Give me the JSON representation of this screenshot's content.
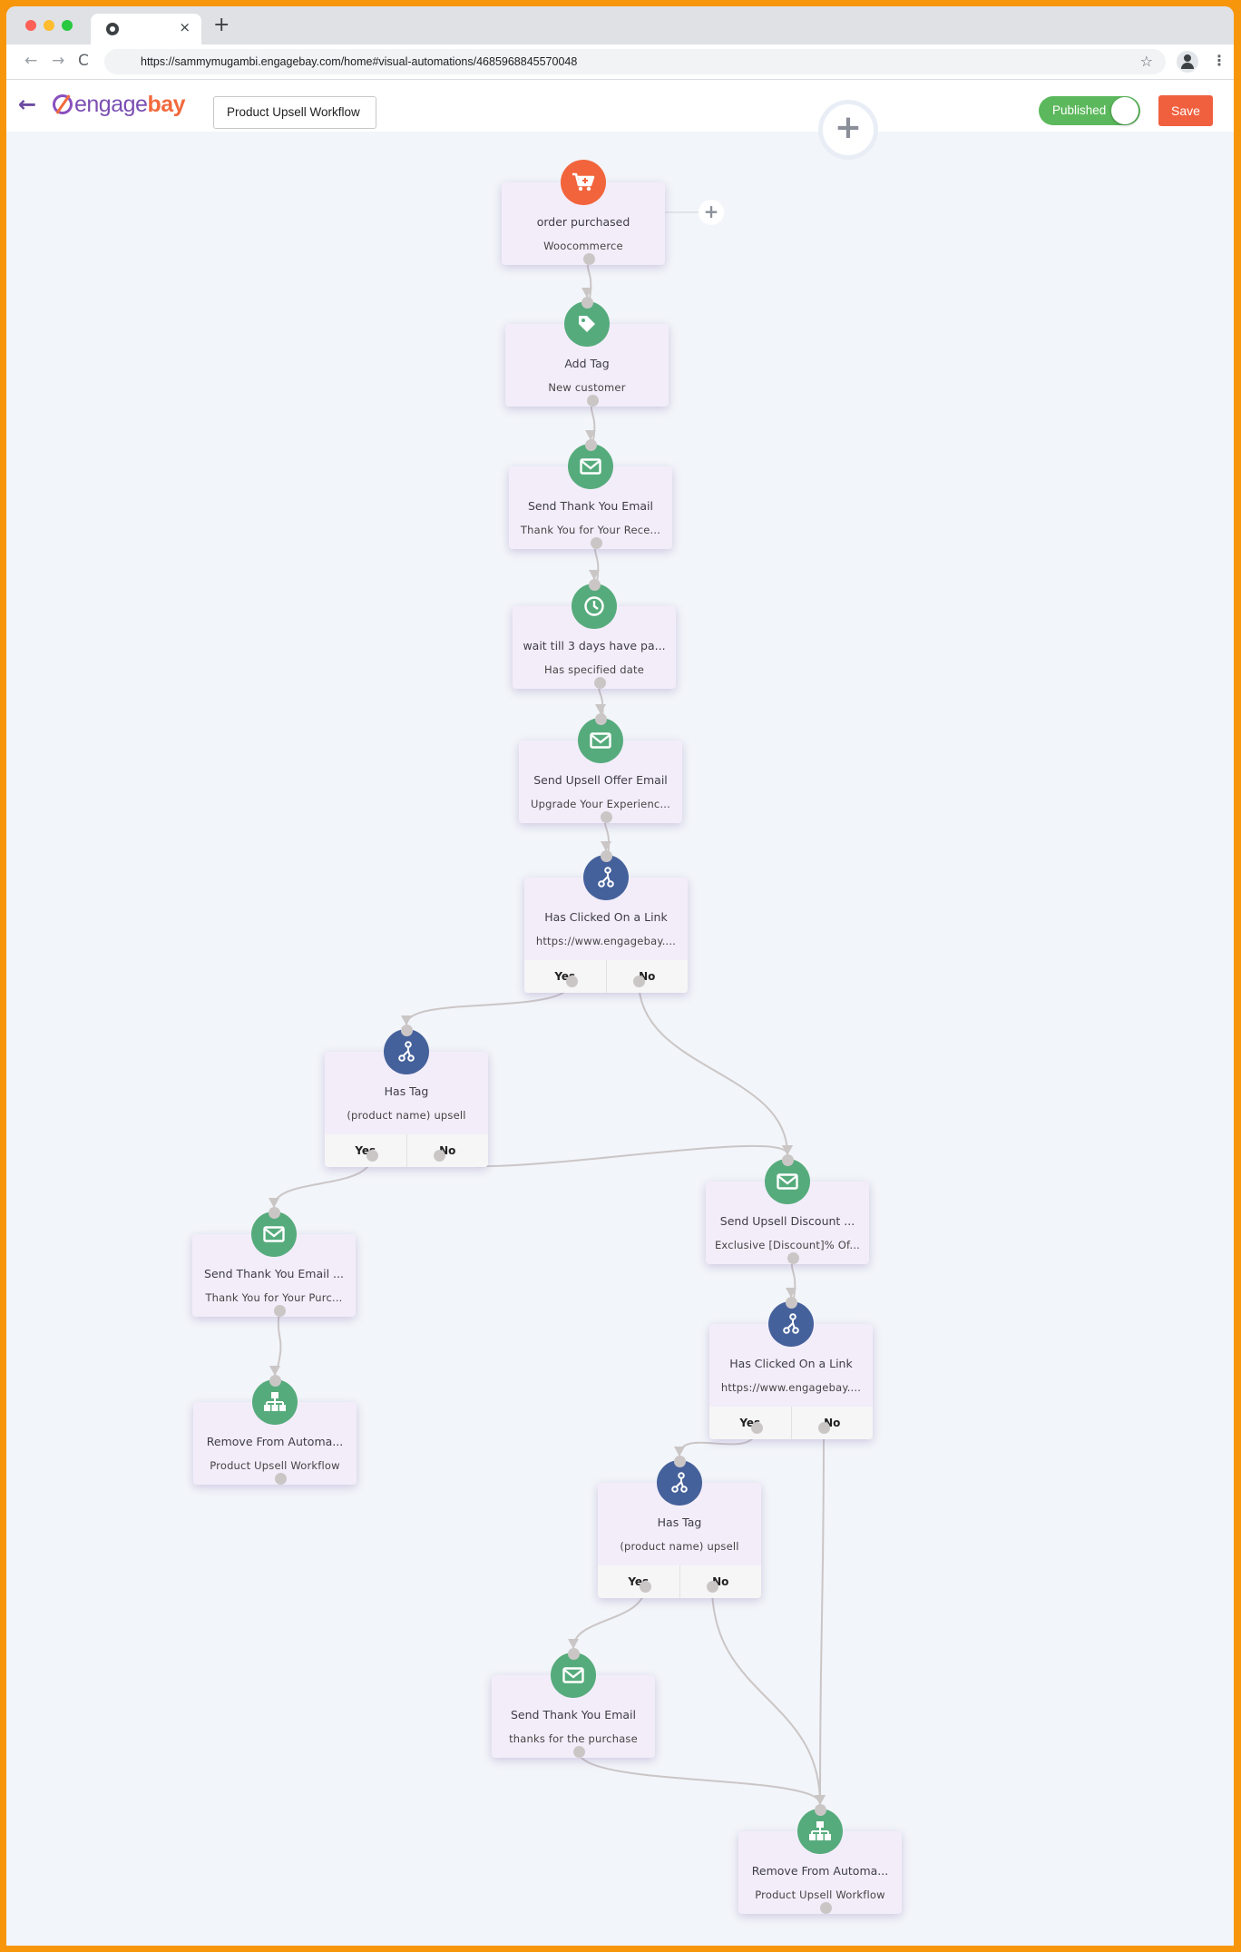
{
  "browser": {
    "tab_close": "×",
    "new_tab": "+",
    "url": "https://sammymugambi.engagebay.com/home#visual-automations/4685968845570048",
    "nav": {
      "back": "←",
      "forward": "→",
      "reload": "C"
    },
    "bookmark_icon": "☆",
    "menu_icon": "⋮"
  },
  "header": {
    "back_icon": "←",
    "logo": {
      "part1": "engage",
      "part2": "bay"
    },
    "workflow_name": "Product Upsell Workflow",
    "published_label": "Published",
    "published": true,
    "save_label": "Save",
    "add_step_label": "+"
  },
  "colors": {
    "frame": "#f7960b",
    "accent_green": "#56ab7c",
    "trigger_orange": "#f2643b",
    "condition_blue": "#45619b",
    "published_green": "#5cb85c",
    "save_red": "#f0603e",
    "node_bg": "#f3edfa"
  },
  "trigger_add_label": "+",
  "nodes": [
    {
      "id": "n1",
      "type": "trigger",
      "icon": "cart-icon",
      "title": "order purchased",
      "subtitle": "Woocommerce"
    },
    {
      "id": "n2",
      "type": "action",
      "icon": "tag-icon",
      "title": "Add Tag",
      "subtitle": "New customer"
    },
    {
      "id": "n3",
      "type": "action",
      "icon": "email-icon",
      "title": "Send Thank You Email",
      "subtitle": "Thank You for Your Rece..."
    },
    {
      "id": "n4",
      "type": "action",
      "icon": "clock-icon",
      "title": "wait till 3 days have pa...",
      "subtitle": "Has specified date"
    },
    {
      "id": "n5",
      "type": "action",
      "icon": "email-icon",
      "title": "Send Upsell Offer Email",
      "subtitle": "Upgrade Your Experienc..."
    },
    {
      "id": "n6",
      "type": "condition",
      "icon": "branch-icon",
      "title": "Has Clicked On a Link",
      "subtitle": "https://www.engagebay....",
      "yes": "Yes",
      "no": "No"
    },
    {
      "id": "n7",
      "type": "condition",
      "icon": "branch-icon",
      "title": "Has Tag",
      "subtitle": "(product name) upsell",
      "yes": "Yes",
      "no": "No"
    },
    {
      "id": "n8",
      "type": "action",
      "icon": "email-icon",
      "title": "Send Thank You Email ...",
      "subtitle": "Thank You for Your Purc..."
    },
    {
      "id": "n9",
      "type": "action",
      "icon": "workflow-icon",
      "title": "Remove From Automa...",
      "subtitle": "Product Upsell Workflow"
    },
    {
      "id": "n10",
      "type": "action",
      "icon": "email-icon",
      "title": "Send Upsell Discount ...",
      "subtitle": "Exclusive [Discount]% Of..."
    },
    {
      "id": "n11",
      "type": "condition",
      "icon": "branch-icon",
      "title": "Has Clicked On a Link",
      "subtitle": "https://www.engagebay....",
      "yes": "Yes",
      "no": "No"
    },
    {
      "id": "n12",
      "type": "condition",
      "icon": "branch-icon",
      "title": "Has Tag",
      "subtitle": "(product name) upsell",
      "yes": "Yes",
      "no": "No"
    },
    {
      "id": "n13",
      "type": "action",
      "icon": "email-icon",
      "title": "Send Thank You Email",
      "subtitle": "thanks for the purchase"
    },
    {
      "id": "n14",
      "type": "action",
      "icon": "workflow-icon",
      "title": "Remove From Automa...",
      "subtitle": "Product Upsell Workflow"
    }
  ],
  "connections": [
    {
      "from": "n1",
      "to": "n2"
    },
    {
      "from": "n2",
      "to": "n3"
    },
    {
      "from": "n3",
      "to": "n4"
    },
    {
      "from": "n4",
      "to": "n5"
    },
    {
      "from": "n5",
      "to": "n6"
    },
    {
      "from": "n6",
      "branch": "yes",
      "to": "n7"
    },
    {
      "from": "n6",
      "branch": "no",
      "to": "n10"
    },
    {
      "from": "n7",
      "branch": "yes",
      "to": "n8"
    },
    {
      "from": "n7",
      "branch": "no",
      "to": "n10"
    },
    {
      "from": "n8",
      "to": "n9"
    },
    {
      "from": "n10",
      "to": "n11"
    },
    {
      "from": "n11",
      "branch": "yes",
      "to": "n12"
    },
    {
      "from": "n11",
      "branch": "no",
      "to": "n14"
    },
    {
      "from": "n12",
      "branch": "yes",
      "to": "n13"
    },
    {
      "from": "n12",
      "branch": "no",
      "to": "n14"
    },
    {
      "from": "n13",
      "to": "n14"
    }
  ]
}
